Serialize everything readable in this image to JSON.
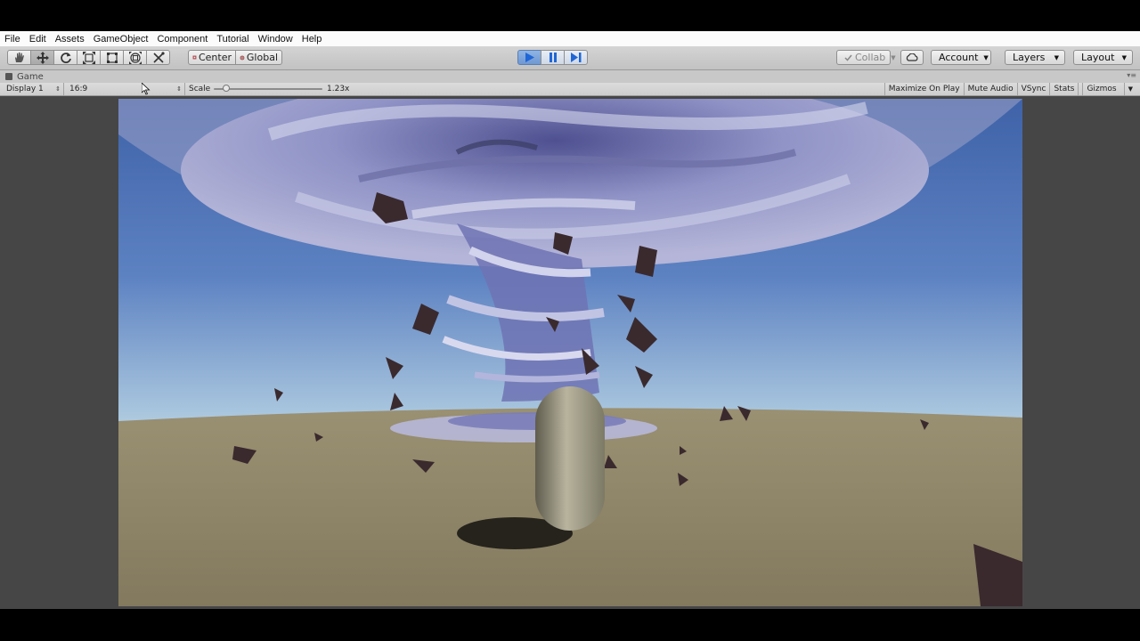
{
  "menu": [
    "File",
    "Edit",
    "Assets",
    "GameObject",
    "Component",
    "Tutorial",
    "Window",
    "Help"
  ],
  "toolbar": {
    "tools": [
      {
        "name": "hand-tool-icon"
      },
      {
        "name": "move-tool-icon"
      },
      {
        "name": "rotate-tool-icon"
      },
      {
        "name": "scale-tool-icon"
      },
      {
        "name": "rect-tool-icon"
      },
      {
        "name": "transform-tool-icon"
      },
      {
        "name": "custom-tool-icon"
      }
    ],
    "active_tool": "move",
    "pivot_label": "Center",
    "space_label": "Global",
    "play_state": "playing",
    "collab_label": "Collab",
    "account_label": "Account",
    "layers_label": "Layers",
    "layout_label": "Layout"
  },
  "tab": {
    "title": "Game"
  },
  "gamebar": {
    "display": "Display 1",
    "aspect": "16:9",
    "scale_label": "Scale",
    "scale_value": "1.23x",
    "maximize": "Maximize On Play",
    "mute": "Mute Audio",
    "vsync": "VSync",
    "stats": "Stats",
    "gizmos": "Gizmos"
  },
  "colors": {
    "play_accent": "#6f98d2",
    "sky_top": "#3f62a8",
    "sky_horizon": "#cfe2ec",
    "ground": "#8c8266",
    "tornado": "#8a8fc4",
    "capsule": "#b2ae98",
    "debris": "#3a2a2e"
  }
}
